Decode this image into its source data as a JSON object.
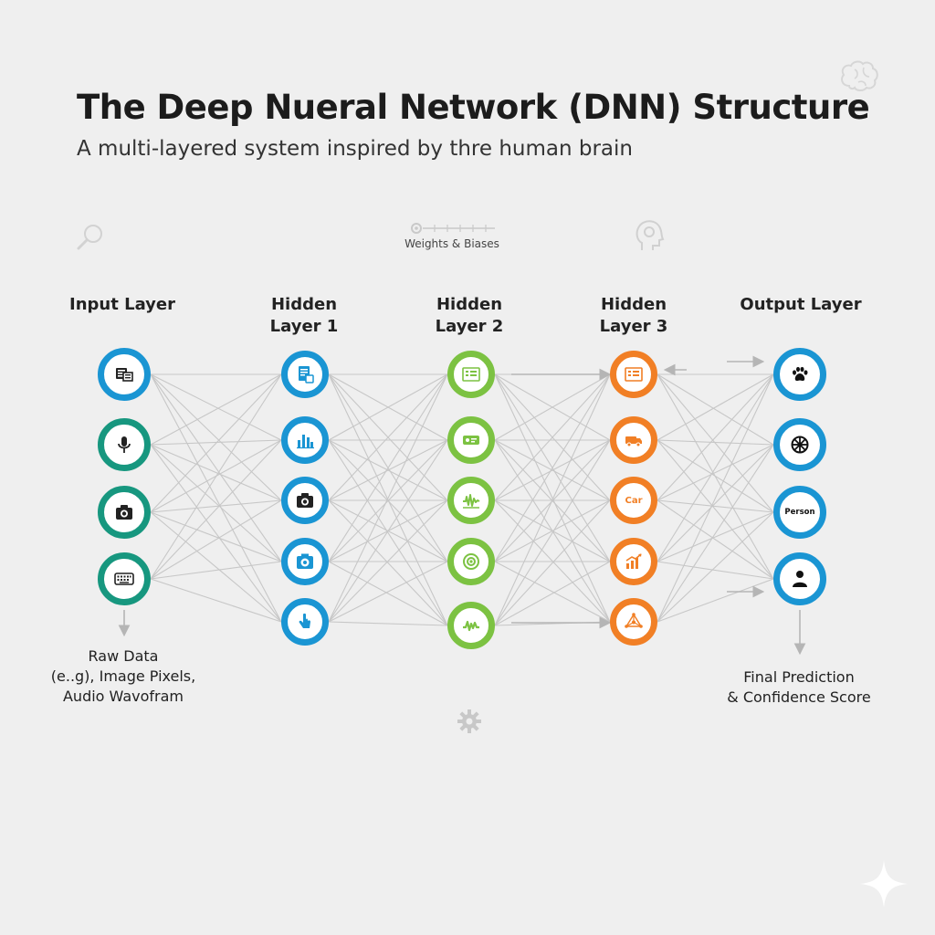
{
  "header": {
    "title": "The Deep Nueral Network (DNN) Structure",
    "subtitle": "A multi-layered system inspired by thre human brain"
  },
  "weights_caption": "Weights & Biases",
  "layers": [
    {
      "title_lines": [
        "Input Layer"
      ],
      "color": "#1a95d3",
      "nodes": [
        {
          "icon": "data-table-icon",
          "color": "#1a95d3"
        },
        {
          "icon": "microphone-icon",
          "color": "#17977f"
        },
        {
          "icon": "camera-icon",
          "color": "#17977f"
        },
        {
          "icon": "keyboard-icon",
          "color": "#17977f"
        }
      ]
    },
    {
      "title_lines": [
        "Hidden",
        "Layer 1"
      ],
      "color": "#1a95d3",
      "nodes": [
        {
          "icon": "document-icon"
        },
        {
          "icon": "bar-chart-icon"
        },
        {
          "icon": "camera-icon"
        },
        {
          "icon": "camera-settings-icon"
        },
        {
          "icon": "hand-pointer-icon"
        }
      ]
    },
    {
      "title_lines": [
        "Hidden",
        "Layer 2"
      ],
      "color": "#7cc242",
      "nodes": [
        {
          "icon": "pattern-grid-icon"
        },
        {
          "icon": "feature-card-icon"
        },
        {
          "icon": "waveform-icon"
        },
        {
          "icon": "target-icon"
        },
        {
          "icon": "signal-wave-icon"
        }
      ]
    },
    {
      "title_lines": [
        "Hidden",
        "Layer 3"
      ],
      "color": "#f17f25",
      "nodes": [
        {
          "icon": "pattern-grid-icon"
        },
        {
          "icon": "truck-icon"
        },
        {
          "icon": "text-label",
          "label": "Car"
        },
        {
          "icon": "growth-chart-icon"
        },
        {
          "icon": "network-icon"
        }
      ]
    },
    {
      "title_lines": [
        "Output Layer"
      ],
      "color": "#1a95d3",
      "nodes": [
        {
          "icon": "paw-icon"
        },
        {
          "icon": "wheel-icon"
        },
        {
          "icon": "text-label",
          "label": "Person"
        },
        {
          "icon": "person-icon"
        }
      ]
    }
  ],
  "input_note": [
    "Raw Data",
    "(e..g), Image Pixels,",
    "Audio Wavofram"
  ],
  "output_note": [
    "Final Prediction",
    "& Confidence Score"
  ],
  "decorations": [
    "brain-icon",
    "magnifier-icon",
    "slider-gear-icon",
    "head-gear-icon",
    "gear-icon",
    "sparkle-icon"
  ]
}
